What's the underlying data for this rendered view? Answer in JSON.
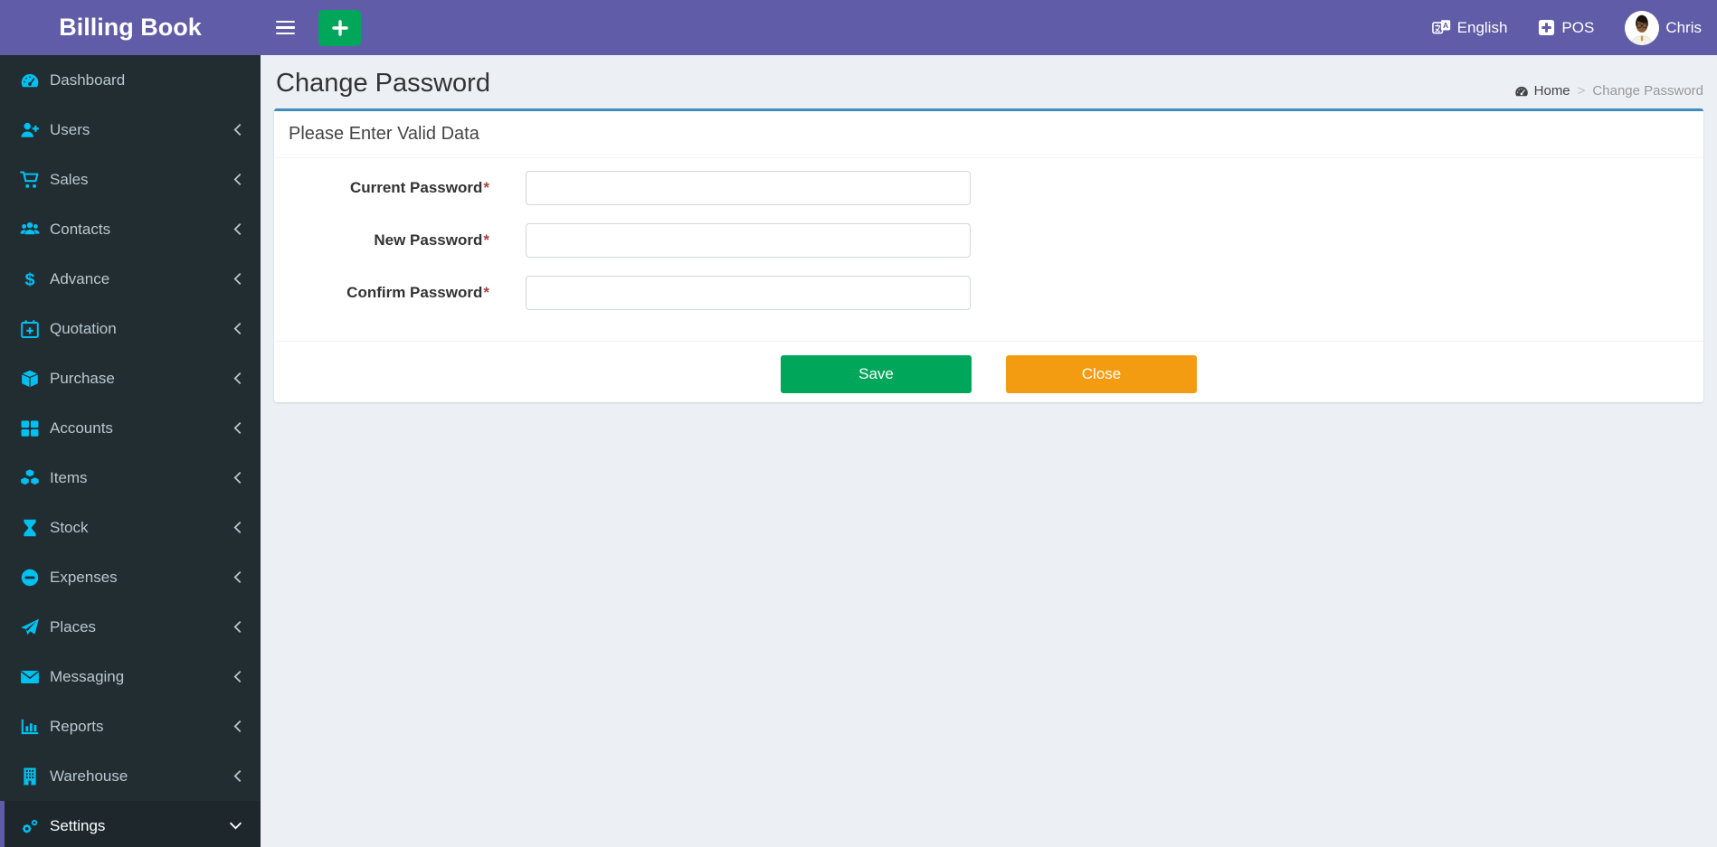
{
  "app": {
    "logo": "Billing Book"
  },
  "topbar": {
    "menu_icon": "hamburger-icon",
    "quick_add_icon": "plus-icon",
    "language": "English",
    "language_icon": "language-icon",
    "pos": "POS",
    "pos_icon": "plus-square-icon",
    "username": "Chris",
    "avatar_icon": "user-avatar"
  },
  "sidebar": {
    "items": [
      {
        "label": "Dashboard",
        "icon": "tachometer-icon",
        "active": false
      },
      {
        "label": "Users",
        "icon": "user-plus-icon",
        "active": false
      },
      {
        "label": "Sales",
        "icon": "cart-icon",
        "active": false
      },
      {
        "label": "Contacts",
        "icon": "users-icon",
        "active": false
      },
      {
        "label": "Advance",
        "icon": "dollar-icon",
        "active": false
      },
      {
        "label": "Quotation",
        "icon": "calendar-plus-icon",
        "active": false
      },
      {
        "label": "Purchase",
        "icon": "cube-icon",
        "active": false
      },
      {
        "label": "Accounts",
        "icon": "grid-icon",
        "active": false
      },
      {
        "label": "Items",
        "icon": "cubes-icon",
        "active": false
      },
      {
        "label": "Stock",
        "icon": "hourglass-icon",
        "active": false
      },
      {
        "label": "Expenses",
        "icon": "minus-circle-icon",
        "active": false
      },
      {
        "label": "Places",
        "icon": "paper-plane-icon",
        "active": false
      },
      {
        "label": "Messaging",
        "icon": "envelope-icon",
        "active": false
      },
      {
        "label": "Reports",
        "icon": "bar-chart-icon",
        "active": false
      },
      {
        "label": "Warehouse",
        "icon": "building-icon",
        "active": false
      },
      {
        "label": "Settings",
        "icon": "gears-icon",
        "active": true
      }
    ]
  },
  "page": {
    "title": "Change Password",
    "breadcrumb": {
      "home": "Home",
      "home_icon": "dashboard-icon",
      "separator": ">",
      "current": "Change Password"
    }
  },
  "card": {
    "title": "Please Enter Valid Data",
    "fields": [
      {
        "label": "Current Password",
        "required_mark": "*",
        "value": ""
      },
      {
        "label": "New Password",
        "required_mark": "*",
        "value": ""
      },
      {
        "label": "Confirm Password",
        "required_mark": "*",
        "value": ""
      }
    ],
    "save_label": "Save",
    "close_label": "Close"
  },
  "colors": {
    "header_purple": "#605ca8",
    "sidebar_dark": "#222d32",
    "sidebar_active": "#1e282c",
    "icon_cyan": "#00c0ef",
    "content_bg": "#ecf0f5",
    "card_top_border": "#3c8dbc",
    "save_green": "#00a65a",
    "close_orange": "#f39c12",
    "required_red": "#a94442"
  }
}
